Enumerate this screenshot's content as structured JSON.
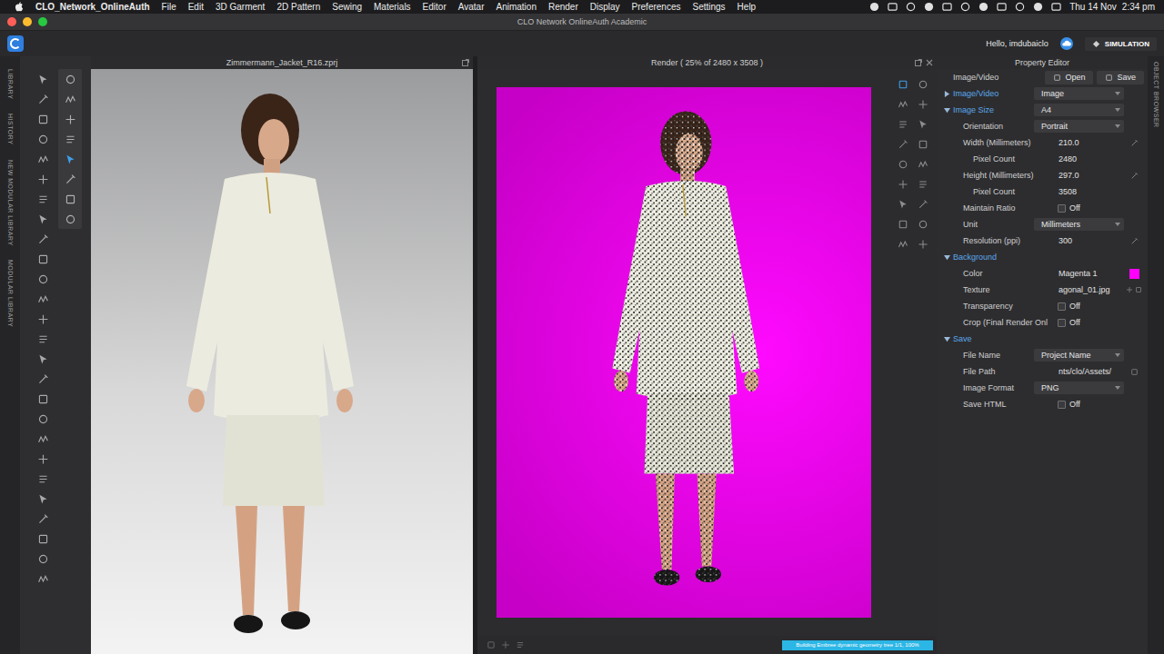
{
  "menubar": {
    "app": "CLO_Network_OnlineAuth",
    "items": [
      "File",
      "Edit",
      "3D Garment",
      "2D Pattern",
      "Sewing",
      "Materials",
      "Editor",
      "Avatar",
      "Animation",
      "Render",
      "Display",
      "Preferences",
      "Settings",
      "Help"
    ],
    "date": "Thu 14 Nov",
    "time": "2:34 pm"
  },
  "window": {
    "title": "CLO Network OnlineAuth Academic"
  },
  "toolbar": {
    "greeting": "Hello, imdubaiclo",
    "mode": "SIMULATION"
  },
  "side_tabs": [
    "LIBRARY",
    "HISTORY",
    "NEW MODULAR LIBRARY",
    "MODULAR LIBRARY"
  ],
  "right_tabs": [
    "OBJECT BROWSER"
  ],
  "viewport": {
    "title": "Zimmermann_Jacket_R16.zprj"
  },
  "render": {
    "title": "Render ( 25% of 2480 x 3508 )",
    "background": "#ff00ff",
    "progress": {
      "text": "Building Embree dynamic geometry tree 1/1, 100%",
      "level": 1
    }
  },
  "property_editor": {
    "title": "Property Editor",
    "rows": [
      {
        "kind": "buttons",
        "label": "Image/Video",
        "indent": 0,
        "buttons": [
          "Open",
          "Save"
        ]
      },
      {
        "kind": "section",
        "label": "Image/Video",
        "indent": 0,
        "expanded": false,
        "value": "Image"
      },
      {
        "kind": "section",
        "label": "Image Size",
        "indent": 0,
        "expanded": true,
        "value": "A4"
      },
      {
        "kind": "dropdown",
        "label": "Orientation",
        "indent": 1,
        "value": "Portrait"
      },
      {
        "kind": "input",
        "label": "Width (Millimeters)",
        "indent": 1,
        "value": "210.0"
      },
      {
        "kind": "value",
        "label": "Pixel Count",
        "indent": 2,
        "value": "2480"
      },
      {
        "kind": "input",
        "label": "Height (Millimeters)",
        "indent": 1,
        "value": "297.0"
      },
      {
        "kind": "value",
        "label": "Pixel Count",
        "indent": 2,
        "value": "3508"
      },
      {
        "kind": "toggle",
        "label": "Maintain Ratio",
        "indent": 1,
        "value": "Off",
        "on": false
      },
      {
        "kind": "dropdown",
        "label": "Unit",
        "indent": 1,
        "value": "Millimeters"
      },
      {
        "kind": "input",
        "label": "Resolution (ppi)",
        "indent": 1,
        "value": "300"
      },
      {
        "kind": "section",
        "label": "Background",
        "indent": 0,
        "expanded": true
      },
      {
        "kind": "color",
        "label": "Color",
        "indent": 1,
        "value": "Magenta 1",
        "color": "#ff00ff"
      },
      {
        "kind": "texture",
        "label": "Texture",
        "indent": 1,
        "value": "agonal_01.jpg"
      },
      {
        "kind": "toggle",
        "label": "Transparency",
        "indent": 1,
        "value": "Off",
        "on": false
      },
      {
        "kind": "toggle",
        "label": "Crop (Final Render Onl",
        "indent": 1,
        "value": "Off",
        "on": false
      },
      {
        "kind": "section",
        "label": "Save",
        "indent": 0,
        "expanded": true
      },
      {
        "kind": "dropdown",
        "label": "File Name",
        "indent": 1,
        "value": "Project Name"
      },
      {
        "kind": "path",
        "label": "File Path",
        "indent": 1,
        "value": "nts/clo/Assets/"
      },
      {
        "kind": "dropdown",
        "label": "Image Format",
        "indent": 1,
        "value": "PNG"
      },
      {
        "kind": "toggle",
        "label": "Save HTML",
        "indent": 1,
        "value": "Off",
        "on": false
      }
    ]
  }
}
